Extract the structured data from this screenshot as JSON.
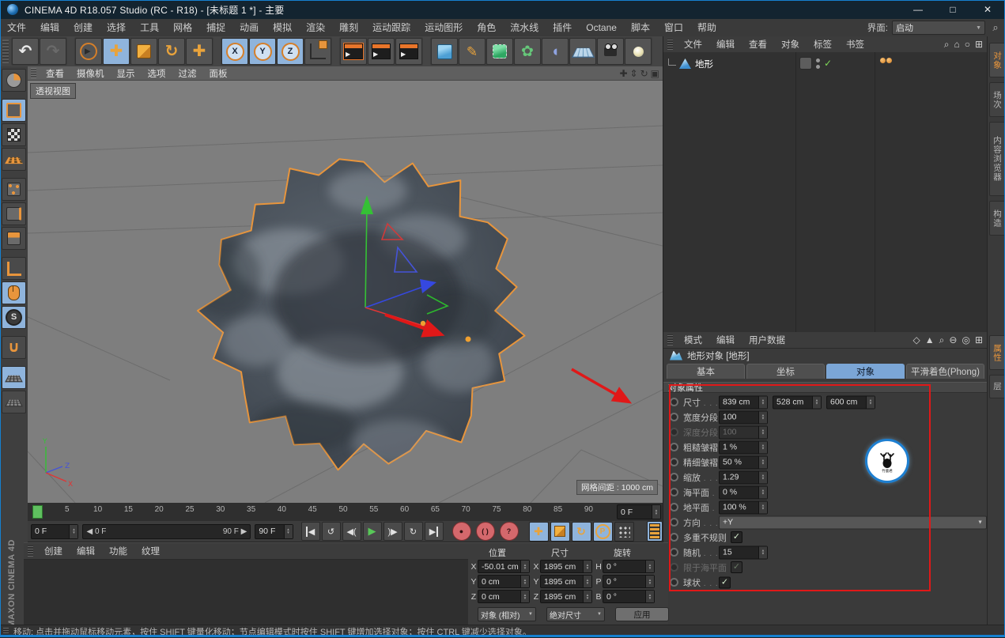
{
  "window": {
    "title": "CINEMA 4D R18.057 Studio (RC - R18) - [未标题 1 *] - 主要",
    "minimize": "—",
    "maximize": "□",
    "close": "✕"
  },
  "menubar": {
    "items": [
      "文件",
      "编辑",
      "创建",
      "选择",
      "工具",
      "网格",
      "捕捉",
      "动画",
      "模拟",
      "渲染",
      "雕刻",
      "运动跟踪",
      "运动图形",
      "角色",
      "流水线",
      "插件",
      "Octane",
      "脚本",
      "窗口",
      "帮助"
    ],
    "interface_label": "界面:",
    "interface_value": "启动",
    "search_icon": "⌕"
  },
  "toolbar": {
    "groups": [
      {
        "items": [
          {
            "name": "undo",
            "cls": "i-undo",
            "glyph": "↶"
          },
          {
            "name": "redo",
            "cls": "i-redo",
            "glyph": "↷"
          }
        ]
      },
      {
        "items": [
          {
            "name": "live-selection",
            "cls": "i-select",
            "glyph": "▲"
          },
          {
            "name": "move",
            "cls": "i-move",
            "glyph": "✚",
            "active": true
          },
          {
            "name": "scale",
            "cls": "i-scale",
            "glyph": ""
          },
          {
            "name": "rotate",
            "cls": "i-rotate",
            "glyph": "↻"
          },
          {
            "name": "last-tool-move",
            "cls": "i-move2",
            "glyph": "✚"
          }
        ]
      },
      {
        "items": [
          {
            "name": "lock-x",
            "cls": "i-axis",
            "glyph": "X",
            "active": true
          },
          {
            "name": "lock-y",
            "cls": "i-axis",
            "glyph": "Y",
            "active": true
          },
          {
            "name": "lock-z",
            "cls": "i-axis",
            "glyph": "Z",
            "active": true
          },
          {
            "name": "coordinate-system",
            "cls": "i-coords",
            "glyph": ""
          }
        ]
      },
      {
        "items": [
          {
            "name": "render-view",
            "cls": "i-clap1",
            "glyph": "▶"
          },
          {
            "name": "render-picture-viewer",
            "cls": "i-clap2",
            "glyph": "▶"
          },
          {
            "name": "render-settings",
            "cls": "i-clap3",
            "glyph": "▶"
          }
        ]
      },
      {
        "items": [
          {
            "name": "primitive-cube",
            "cls": "i-cube",
            "glyph": ""
          },
          {
            "name": "spline-pen",
            "cls": "i-pen",
            "glyph": "✎"
          },
          {
            "name": "subdivision-surface",
            "cls": "i-sds",
            "glyph": ""
          },
          {
            "name": "modeling-commands",
            "cls": "i-flower",
            "glyph": "✿"
          },
          {
            "name": "deformers",
            "cls": "i-shell",
            "glyph": "◖"
          },
          {
            "name": "floor-objects",
            "cls": "i-floor",
            "glyph": ""
          },
          {
            "name": "camera-objects",
            "cls": "i-camera",
            "glyph": ""
          },
          {
            "name": "light-objects",
            "cls": "i-light",
            "glyph": ""
          }
        ]
      }
    ]
  },
  "palette": {
    "items": [
      {
        "name": "make-editable",
        "cls": "p-editable"
      },
      {
        "name": "model-mode",
        "cls": "p-model",
        "active": true,
        "gap_before": true
      },
      {
        "name": "texture-mode",
        "cls": "p-texture"
      },
      {
        "name": "workplane-mode",
        "cls": "p-workplane"
      },
      {
        "name": "points-mode",
        "cls": "p-points",
        "gap_before": true
      },
      {
        "name": "edges-mode",
        "cls": "p-edges"
      },
      {
        "name": "polygons-mode",
        "cls": "p-polys"
      },
      {
        "name": "axis-mode",
        "cls": "p-axis",
        "gap_before": true
      },
      {
        "name": "viewport-solo",
        "cls": "p-mouse",
        "active": true
      },
      {
        "name": "snap-enable",
        "cls": "p-snap",
        "active": true,
        "glyph": "S"
      },
      {
        "name": "magnet-tool",
        "cls": "p-magnet",
        "glyph": "∪",
        "gap_before": true
      },
      {
        "name": "workplane-snap",
        "cls": "p-wsnap",
        "active": true,
        "gap_before": true
      },
      {
        "name": "grid-snap",
        "cls": "p-gsnap"
      }
    ]
  },
  "viewport": {
    "menus": [
      "查看",
      "摄像机",
      "显示",
      "选项",
      "过滤",
      "面板"
    ],
    "corner_icons": [
      {
        "name": "pan-view-icon",
        "glyph": "✚"
      },
      {
        "name": "zoom-view-icon",
        "glyph": "⇕"
      },
      {
        "name": "rotate-view-icon",
        "glyph": "↻"
      },
      {
        "name": "toggle-view-icon",
        "glyph": "▣"
      }
    ],
    "view_label": "透视视图",
    "grid_spacing": "网格间距 : 1000 cm",
    "axis_labels": {
      "x": "X",
      "y": "Y",
      "z": "Z"
    }
  },
  "object_manager": {
    "menus": [
      "文件",
      "编辑",
      "查看",
      "对象",
      "标签",
      "书签"
    ],
    "icons": [
      {
        "name": "search-icon",
        "glyph": "⌕"
      },
      {
        "name": "home-icon",
        "glyph": "⌂"
      },
      {
        "name": "path-icon",
        "glyph": "○"
      },
      {
        "name": "add-icon",
        "glyph": "⊞"
      }
    ],
    "objects": [
      {
        "name": "地形"
      }
    ]
  },
  "right_tabs": {
    "top": [
      {
        "label": "对象",
        "active": true
      },
      {
        "label": "场次"
      },
      {
        "label": "内容浏览器"
      },
      {
        "label": "构造"
      }
    ],
    "bottom": [
      {
        "label": "属性",
        "active": true
      },
      {
        "label": "层"
      }
    ]
  },
  "attribute_manager": {
    "menus": [
      "模式",
      "编辑",
      "用户数据"
    ],
    "icons": [
      {
        "name": "history-icon",
        "glyph": "◇"
      },
      {
        "name": "arrow-icon",
        "glyph": "▲"
      },
      {
        "name": "search-icon",
        "glyph": "⌕"
      },
      {
        "name": "lock-icon",
        "glyph": "⊖"
      },
      {
        "name": "target-icon",
        "glyph": "◎"
      },
      {
        "name": "add-icon",
        "glyph": "⊞"
      }
    ],
    "object_title": "地形对象 [地形]",
    "tabs": [
      {
        "label": "基本"
      },
      {
        "label": "坐标"
      },
      {
        "label": "对象",
        "active": true
      },
      {
        "label": "平滑着色(Phong)"
      }
    ],
    "section_title": "对象属性",
    "rows": [
      {
        "label": "尺寸",
        "type": "fields",
        "values": [
          "839 cm",
          "528 cm",
          "600 cm"
        ]
      },
      {
        "label": "宽度分段",
        "type": "fields",
        "values": [
          "100"
        ]
      },
      {
        "label": "深度分段",
        "type": "fields",
        "values": [
          "100"
        ],
        "disabled": true
      },
      {
        "label": "粗糙皱褶",
        "type": "fields",
        "values": [
          "1 %"
        ]
      },
      {
        "label": "精细皱褶",
        "type": "fields",
        "values": [
          "50 %"
        ]
      },
      {
        "label": "缩放",
        "type": "fields",
        "values": [
          "1.29"
        ]
      },
      {
        "label": "海平面",
        "type": "fields",
        "values": [
          "0 %"
        ]
      },
      {
        "label": "地平面",
        "type": "fields",
        "values": [
          "100 %"
        ]
      },
      {
        "label": "方向",
        "type": "dropdown",
        "values": [
          "+Y"
        ]
      },
      {
        "label": "多重不规则",
        "type": "checkbox",
        "checked": true,
        "flow": true
      },
      {
        "label": "随机",
        "type": "fields",
        "values": [
          "15"
        ]
      },
      {
        "label": "限于海平面",
        "type": "checkbox",
        "checked": true,
        "disabled": true,
        "flow": true
      },
      {
        "label": "球状",
        "type": "checkbox",
        "checked": true
      }
    ]
  },
  "timeline": {
    "ticks": [
      "0",
      "5",
      "10",
      "15",
      "20",
      "25",
      "30",
      "35",
      "40",
      "45",
      "50",
      "55",
      "60",
      "65",
      "70",
      "75",
      "80",
      "85",
      "90"
    ],
    "current_frame": "0 F",
    "range_start": "0 F",
    "range_end": "90 F",
    "end_frame": "90 F",
    "transport": [
      {
        "name": "goto-start-button",
        "glyph": "◀",
        "cls": "t-start"
      },
      {
        "name": "play-backwards-button",
        "glyph": "↺",
        "cls": ""
      },
      {
        "name": "previous-key-button",
        "glyph": "◀(",
        "cls": ""
      },
      {
        "name": "play-button",
        "glyph": "▶",
        "cls": "t-play"
      },
      {
        "name": "next-key-button",
        "glyph": ")▶",
        "cls": ""
      },
      {
        "name": "loop-button",
        "glyph": "↻",
        "cls": ""
      },
      {
        "name": "goto-end-button",
        "glyph": "▶",
        "cls": "t-end"
      }
    ],
    "record_buttons": [
      {
        "name": "record-button",
        "glyph": "●"
      },
      {
        "name": "autokey-button",
        "glyph": "( )"
      },
      {
        "name": "keyframe-mode-button",
        "glyph": "?"
      }
    ],
    "key_toggles": [
      {
        "name": "key-position-toggle",
        "glyph": "✚",
        "active": true
      },
      {
        "name": "key-scale-toggle",
        "glyph": "",
        "cls": "k-scale",
        "active": true
      },
      {
        "name": "key-rotation-toggle",
        "glyph": "↻",
        "active": true
      },
      {
        "name": "key-parameter-toggle",
        "glyph": "P",
        "cls": "k-param",
        "active": true
      },
      {
        "name": "key-pla-toggle",
        "glyph": "",
        "cls": "k-dots"
      }
    ]
  },
  "material_manager": {
    "menus": [
      "创建",
      "编辑",
      "功能",
      "纹理"
    ]
  },
  "coordinates": {
    "groups": [
      {
        "title": "位置",
        "rows": [
          {
            "axis": "X",
            "value": "-50.01 cm"
          },
          {
            "axis": "Y",
            "value": "0 cm"
          },
          {
            "axis": "Z",
            "value": "0 cm"
          }
        ]
      },
      {
        "title": "尺寸",
        "rows": [
          {
            "axis": "X",
            "value": "1895 cm"
          },
          {
            "axis": "Y",
            "value": "1895 cm"
          },
          {
            "axis": "Z",
            "value": "1895 cm"
          }
        ]
      },
      {
        "title": "旋转",
        "rows": [
          {
            "axis": "H",
            "value": "0 °"
          },
          {
            "axis": "P",
            "value": "0 °"
          },
          {
            "axis": "B",
            "value": "0 °"
          }
        ]
      }
    ],
    "mode_object": "对象 (相对)",
    "mode_size": "绝对尺寸",
    "apply_label": "应用"
  },
  "status_bar": {
    "text": "移动: 点击并拖动鼠标移动元素，按住 SHIFT 键量化移动；节点编辑模式时按住 SHIFT 键增加选择对象；按住 CTRL 键减少选择对象。"
  },
  "branding": {
    "vertical_text": "MAXON CINEMA 4D"
  },
  "colors": {
    "accent_orange": "#e8953c",
    "selection_blue": "#7ba6d6",
    "annotation_red": "#e01818",
    "viewport_gray": "#7e7e7e",
    "terrain_fill": "#4a525b"
  }
}
